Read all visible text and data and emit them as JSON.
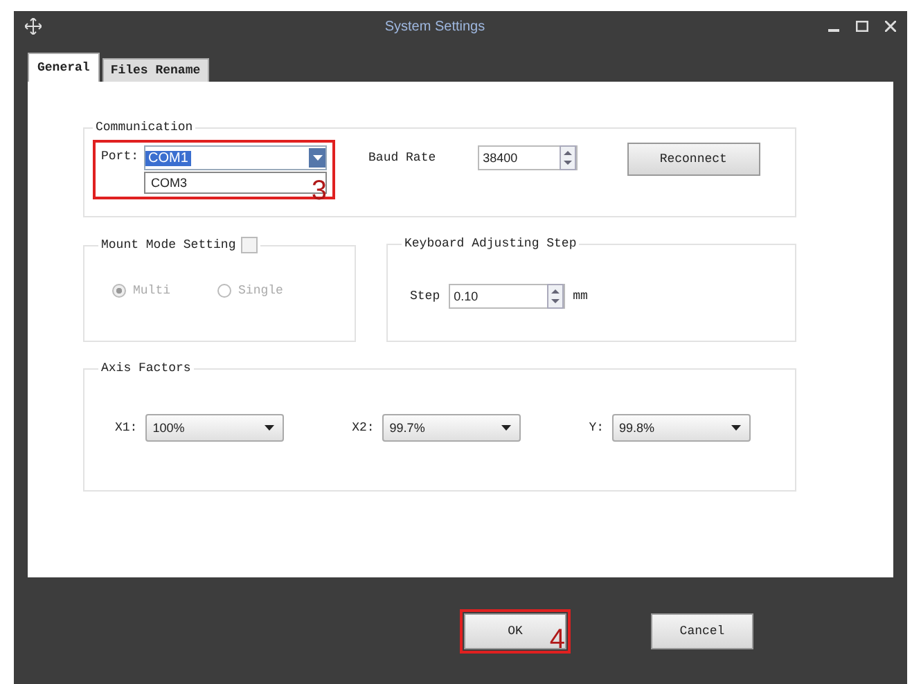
{
  "window": {
    "title": "System Settings"
  },
  "tabs": [
    {
      "label": "General",
      "selected": true
    },
    {
      "label": "Files Rename",
      "selected": false
    }
  ],
  "communication": {
    "title": "Communication",
    "port": {
      "label": "Port:",
      "value": "COM1",
      "list_items": [
        "COM3"
      ]
    },
    "annotation": "3",
    "baud_rate": {
      "label": "Baud Rate",
      "value": "38400"
    },
    "reconnect_button": "Reconnect"
  },
  "mount_mode": {
    "title": "Mount Mode Setting",
    "checked": false,
    "disabled": true,
    "options": [
      {
        "label": "Multi",
        "selected": true
      },
      {
        "label": "Single",
        "selected": false
      }
    ]
  },
  "keyboard_step": {
    "title": "Keyboard Adjusting Step",
    "label": "Step",
    "value": "0.10",
    "unit": "mm"
  },
  "axis_factors": {
    "title": "Axis Factors",
    "fields": [
      {
        "label": "X1:",
        "value": "100%"
      },
      {
        "label": "X2:",
        "value": "99.7%"
      },
      {
        "label": "Y:",
        "value": "99.8%"
      }
    ]
  },
  "buttons": [
    {
      "label": "OK",
      "annotation": "4"
    },
    {
      "label": "Cancel"
    }
  ]
}
